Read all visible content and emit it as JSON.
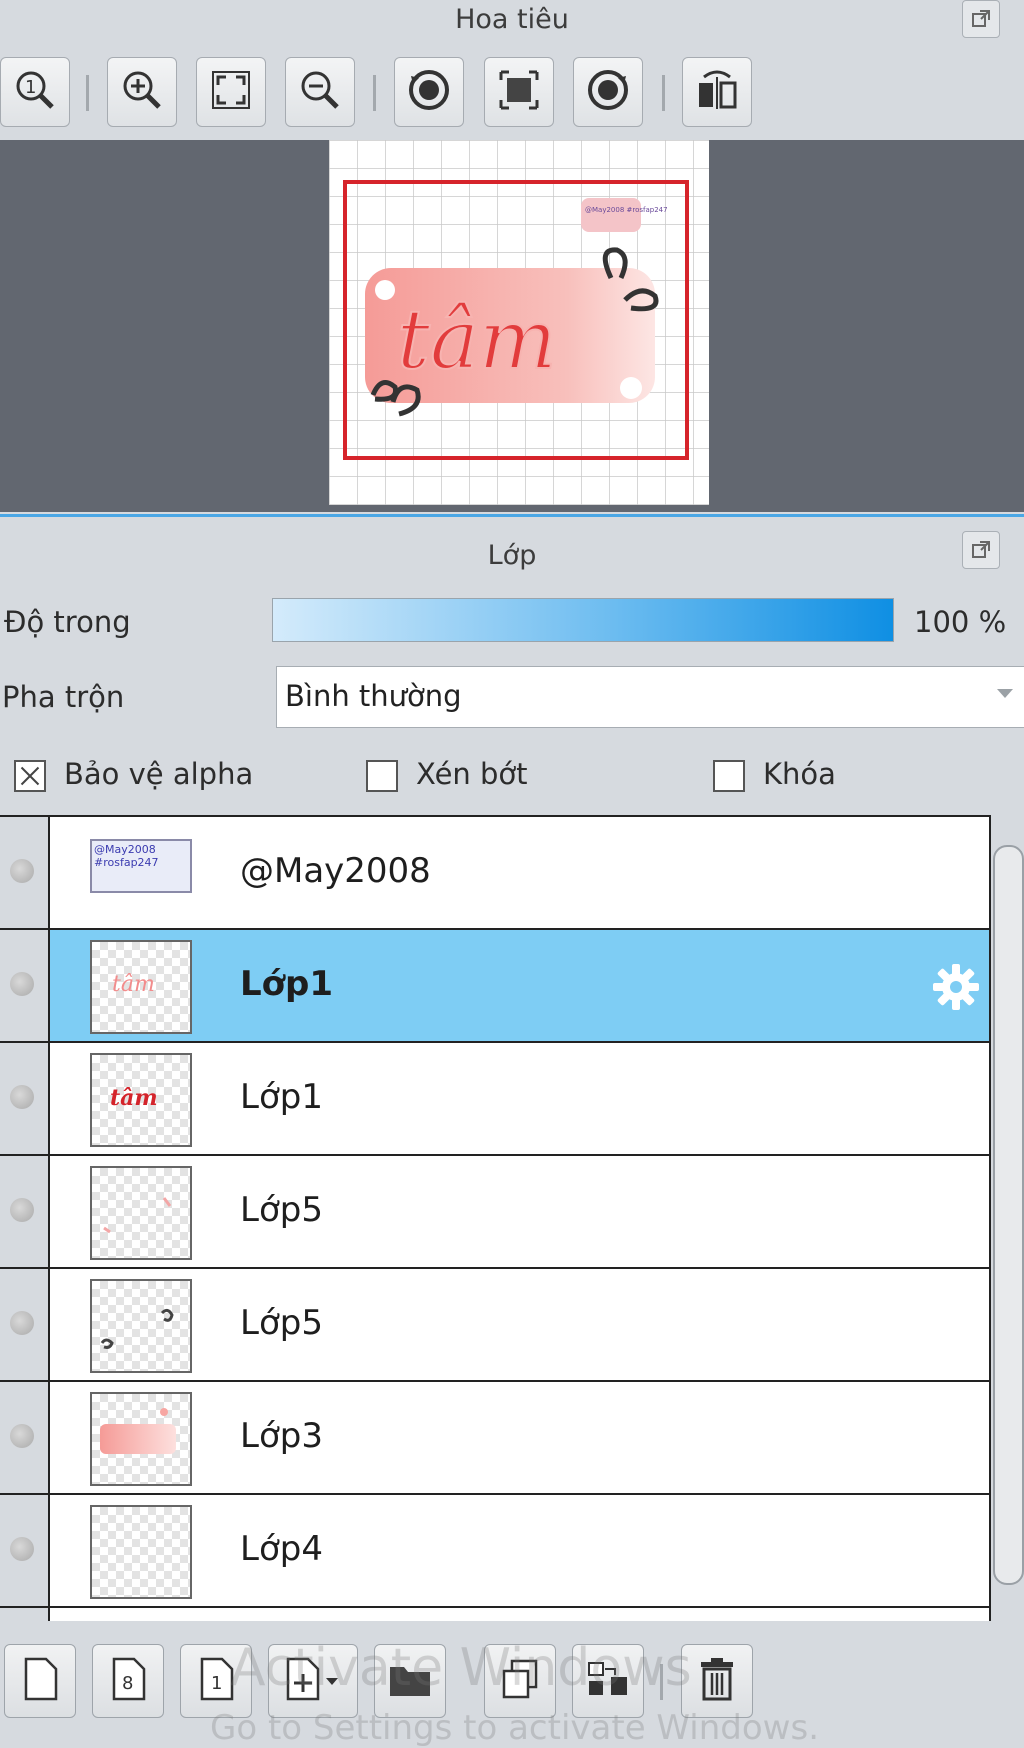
{
  "navigator": {
    "title": "Hoa tiêu",
    "toolbar": [
      {
        "icon": "zoom-actual-size-icon"
      },
      {
        "icon": "zoom-in-icon"
      },
      {
        "icon": "fit-to-window-icon"
      },
      {
        "icon": "zoom-out-icon"
      },
      {
        "icon": "rotate-left-icon"
      },
      {
        "icon": "reset-view-icon"
      },
      {
        "icon": "rotate-right-icon"
      },
      {
        "icon": "flip-horizontal-icon"
      }
    ],
    "preview": {
      "text": "tâm",
      "small_text": "@May2008 #rosfap247",
      "frame_color": "#d6242b",
      "text_color": "#e23c3c",
      "banner_color": "#f7a8a4"
    }
  },
  "layers_panel": {
    "title": "Lớp",
    "opacity_label": "Độ trong",
    "opacity_value": "100 %",
    "opacity_percent": 100,
    "blend_label": "Pha trộn",
    "blend_value": "Bình thường",
    "protect_alpha_label": "Bảo vệ alpha",
    "protect_alpha_checked": true,
    "clipping_label": "Xén bớt",
    "clipping_checked": false,
    "lock_label": "Khóa",
    "lock_checked": false,
    "layers": [
      {
        "name": "@May2008",
        "thumb_line1": "@May2008",
        "thumb_line2": "#rosfap247",
        "selected": false
      },
      {
        "name": "Lớp1",
        "thumb_text": "tâm",
        "selected": true
      },
      {
        "name": "Lớp1",
        "thumb_text": "tâm",
        "selected": false
      },
      {
        "name": "Lớp5",
        "selected": false
      },
      {
        "name": "Lớp5",
        "selected": false
      },
      {
        "name": "Lớp3",
        "selected": false
      },
      {
        "name": "Lớp4",
        "selected": false
      }
    ],
    "bottom_toolbar": [
      {
        "icon": "new-layer-icon"
      },
      {
        "icon": "new-8bit-layer-icon"
      },
      {
        "icon": "new-1bit-layer-icon"
      },
      {
        "icon": "add-layer-menu-icon"
      },
      {
        "icon": "new-folder-icon"
      },
      {
        "icon": "duplicate-layer-icon"
      },
      {
        "icon": "merge-layer-icon"
      },
      {
        "icon": "delete-layer-icon"
      }
    ]
  },
  "watermark": {
    "line1": "Activate Windows",
    "line2": "Go to Settings to activate Windows."
  },
  "colors": {
    "selection": "#7ecdf4",
    "panel_bg": "#d6dadf",
    "canvas_bg": "#626770",
    "accent": "#4aa7e6"
  }
}
